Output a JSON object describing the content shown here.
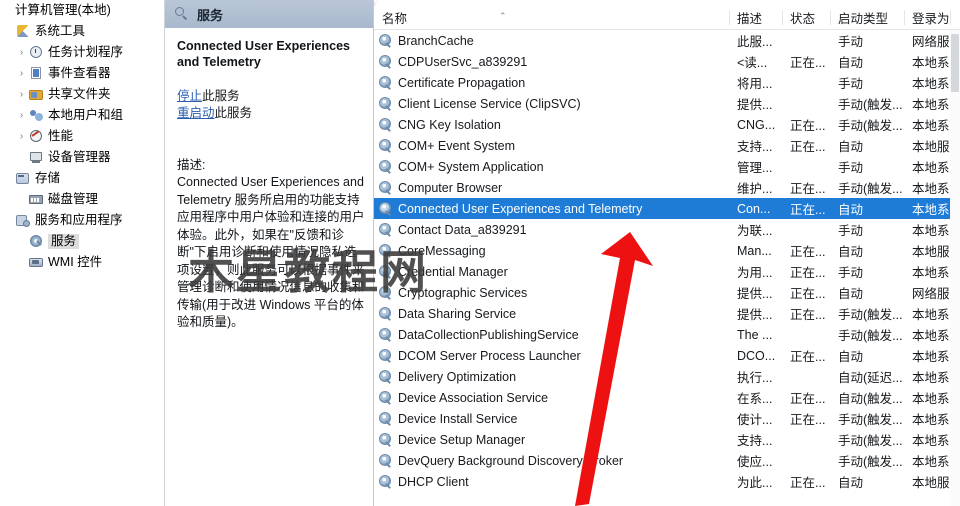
{
  "sidebar": {
    "root_label": "计算机管理(本地)",
    "items": [
      {
        "label": "系统工具",
        "icon": "tools-icon",
        "indent": 0,
        "twisty": "",
        "selected": false
      },
      {
        "label": "任务计划程序",
        "icon": "clock-icon",
        "indent": 1,
        "twisty": "›",
        "selected": false
      },
      {
        "label": "事件查看器",
        "icon": "event-viewer-icon",
        "indent": 1,
        "twisty": "›",
        "selected": false
      },
      {
        "label": "共享文件夹",
        "icon": "shared-folder-icon",
        "indent": 1,
        "twisty": "›",
        "selected": false
      },
      {
        "label": "本地用户和组",
        "icon": "users-icon",
        "indent": 1,
        "twisty": "›",
        "selected": false
      },
      {
        "label": "性能",
        "icon": "performance-icon",
        "indent": 1,
        "twisty": "›",
        "selected": false
      },
      {
        "label": "设备管理器",
        "icon": "device-manager-icon",
        "indent": 1,
        "twisty": "",
        "selected": false
      },
      {
        "label": "存储",
        "icon": "storage-icon",
        "indent": 0,
        "twisty": "",
        "selected": false
      },
      {
        "label": "磁盘管理",
        "icon": "disk-management-icon",
        "indent": 1,
        "twisty": "",
        "selected": false
      },
      {
        "label": "服务和应用程序",
        "icon": "services-apps-icon",
        "indent": 0,
        "twisty": "",
        "selected": false
      },
      {
        "label": "服务",
        "icon": "service-gear-icon",
        "indent": 1,
        "twisty": "",
        "selected": true
      },
      {
        "label": "WMI 控件",
        "icon": "wmi-control-icon",
        "indent": 1,
        "twisty": "",
        "selected": false
      }
    ]
  },
  "detail": {
    "header_title": "服务",
    "service_name": "Connected User Experiences and Telemetry",
    "actions": [
      {
        "link": "停止",
        "rest": "此服务"
      },
      {
        "link": "重启动",
        "rest": "此服务"
      }
    ],
    "description_label": "描述:",
    "description_text": "Connected User Experiences and Telemetry 服务所启用的功能支持应用程序中用户体验和连接的用户体验。此外，如果在\"反馈和诊断\"下启用诊断和使用情况隐私选项设置，则此服务可以根据事件来管理诊断和使用情况信息的收集和传输(用于改进 Windows 平台的体验和质量)。"
  },
  "list": {
    "columns": [
      {
        "label": "名称",
        "key": "name"
      },
      {
        "label": "描述",
        "key": "desc"
      },
      {
        "label": "状态",
        "key": "status"
      },
      {
        "label": "启动类型",
        "key": "startup"
      },
      {
        "label": "登录为",
        "key": "logon"
      }
    ],
    "sort_indicator": "⌃",
    "rows": [
      {
        "name": "BranchCache",
        "desc": "此服...",
        "status": "",
        "startup": "手动",
        "logon": "网络服务",
        "selected": false
      },
      {
        "name": "CDPUserSvc_a839291",
        "desc": "<读...",
        "status": "正在...",
        "startup": "自动",
        "logon": "本地系统",
        "selected": false
      },
      {
        "name": "Certificate Propagation",
        "desc": "将用...",
        "status": "",
        "startup": "手动",
        "logon": "本地系统",
        "selected": false
      },
      {
        "name": "Client License Service (ClipSVC)",
        "desc": "提供...",
        "status": "",
        "startup": "手动(触发...",
        "logon": "本地系统",
        "selected": false
      },
      {
        "name": "CNG Key Isolation",
        "desc": "CNG...",
        "status": "正在...",
        "startup": "手动(触发...",
        "logon": "本地系统",
        "selected": false
      },
      {
        "name": "COM+ Event System",
        "desc": "支持...",
        "status": "正在...",
        "startup": "自动",
        "logon": "本地服务",
        "selected": false
      },
      {
        "name": "COM+ System Application",
        "desc": "管理...",
        "status": "",
        "startup": "手动",
        "logon": "本地系统",
        "selected": false
      },
      {
        "name": "Computer Browser",
        "desc": "维护...",
        "status": "正在...",
        "startup": "手动(触发...",
        "logon": "本地系统",
        "selected": false
      },
      {
        "name": "Connected User Experiences and Telemetry",
        "desc": "Con...",
        "status": "正在...",
        "startup": "自动",
        "logon": "本地系统",
        "selected": true
      },
      {
        "name": "Contact Data_a839291",
        "desc": "为联...",
        "status": "",
        "startup": "手动",
        "logon": "本地系统",
        "selected": false
      },
      {
        "name": "CoreMessaging",
        "desc": "Man...",
        "status": "正在...",
        "startup": "自动",
        "logon": "本地服务",
        "selected": false
      },
      {
        "name": "Credential Manager",
        "desc": "为用...",
        "status": "正在...",
        "startup": "手动",
        "logon": "本地系统",
        "selected": false
      },
      {
        "name": "Cryptographic Services",
        "desc": "提供...",
        "status": "正在...",
        "startup": "自动",
        "logon": "网络服务",
        "selected": false
      },
      {
        "name": "Data Sharing Service",
        "desc": "提供...",
        "status": "正在...",
        "startup": "手动(触发...",
        "logon": "本地系统",
        "selected": false
      },
      {
        "name": "DataCollectionPublishingService",
        "desc": "The ...",
        "status": "",
        "startup": "手动(触发...",
        "logon": "本地系统",
        "selected": false
      },
      {
        "name": "DCOM Server Process Launcher",
        "desc": "DCO...",
        "status": "正在...",
        "startup": "自动",
        "logon": "本地系统",
        "selected": false
      },
      {
        "name": "Delivery Optimization",
        "desc": "执行...",
        "status": "",
        "startup": "自动(延迟...",
        "logon": "本地系统",
        "selected": false
      },
      {
        "name": "Device Association Service",
        "desc": "在系...",
        "status": "正在...",
        "startup": "自动(触发...",
        "logon": "本地系统",
        "selected": false
      },
      {
        "name": "Device Install Service",
        "desc": "使计...",
        "status": "正在...",
        "startup": "手动(触发...",
        "logon": "本地系统",
        "selected": false
      },
      {
        "name": "Device Setup Manager",
        "desc": "支持...",
        "status": "",
        "startup": "手动(触发...",
        "logon": "本地系统",
        "selected": false
      },
      {
        "name": "DevQuery Background Discovery Broker",
        "desc": "使应...",
        "status": "",
        "startup": "手动(触发...",
        "logon": "本地系统",
        "selected": false
      },
      {
        "name": "DHCP Client",
        "desc": "为此...",
        "status": "正在...",
        "startup": "自动",
        "logon": "本地服务",
        "selected": false
      }
    ]
  },
  "overlay": {
    "watermark_text": "木星教程网",
    "watermark_color": "#3a3a3a",
    "arrow_color": "#ee1111",
    "selection_color": "#1f7cd6"
  }
}
